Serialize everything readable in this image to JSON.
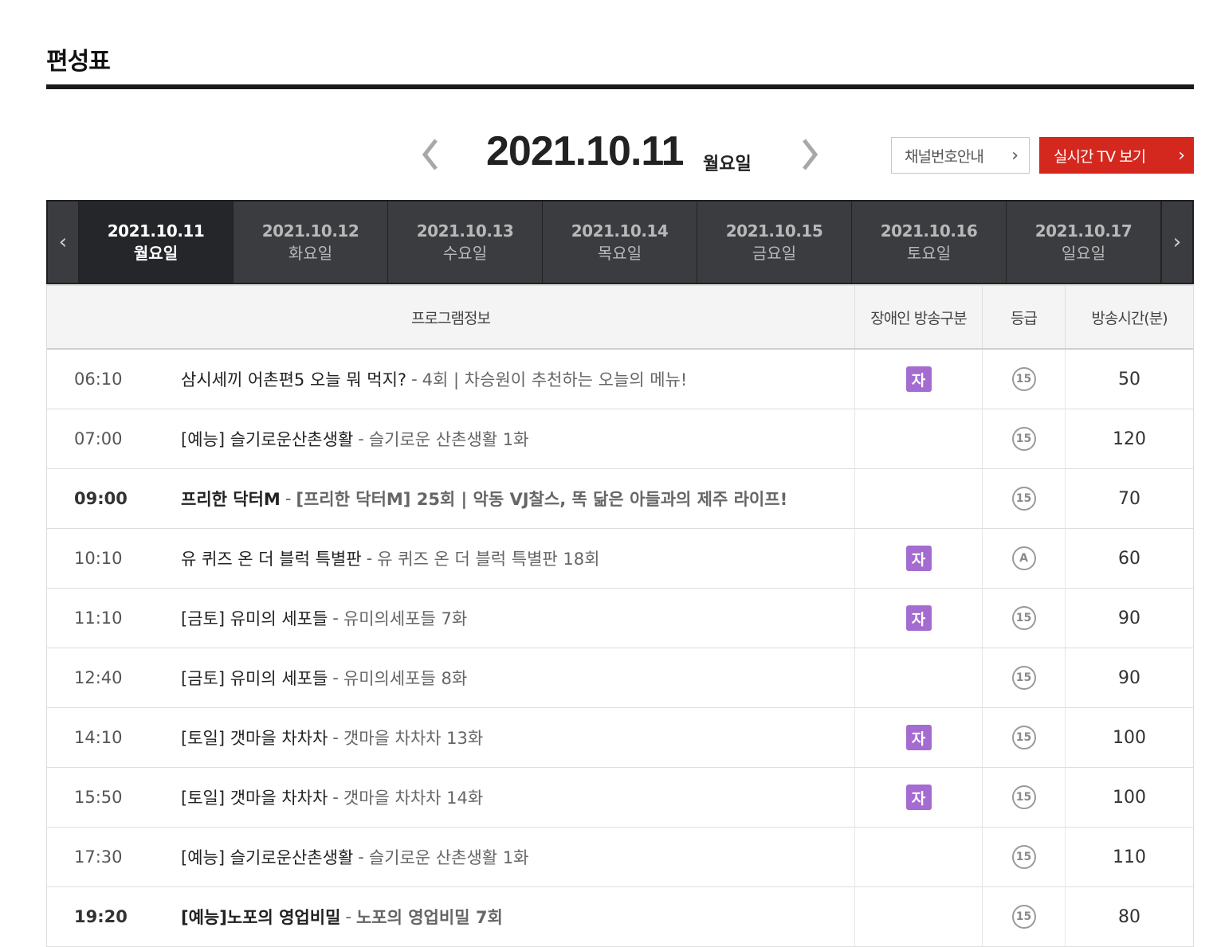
{
  "page": {
    "title": "편성표"
  },
  "date_header": {
    "date": "2021.10.11",
    "day": "월요일",
    "channel_button": "채널번호안내",
    "live_button": "실시간 TV 보기"
  },
  "tabs": [
    {
      "date": "2021.10.11",
      "day": "월요일",
      "active": true
    },
    {
      "date": "2021.10.12",
      "day": "화요일",
      "active": false
    },
    {
      "date": "2021.10.13",
      "day": "수요일",
      "active": false
    },
    {
      "date": "2021.10.14",
      "day": "목요일",
      "active": false
    },
    {
      "date": "2021.10.15",
      "day": "금요일",
      "active": false
    },
    {
      "date": "2021.10.16",
      "day": "토요일",
      "active": false
    },
    {
      "date": "2021.10.17",
      "day": "일요일",
      "active": false
    }
  ],
  "table": {
    "headers": {
      "info": "프로그램정보",
      "cc": "장애인 방송구분",
      "grade": "등급",
      "duration": "방송시간(분)"
    },
    "rows": [
      {
        "time": "06:10",
        "title": "삼시세끼 어촌편5 오늘 뭐 먹지?",
        "episode": "4회 | 차승원이 추천하는 오늘의 메뉴!",
        "cc": "자",
        "grade": "15",
        "duration": "50",
        "bold": false
      },
      {
        "time": "07:00",
        "title": "[예능] 슬기로운산촌생활",
        "episode": "슬기로운 산촌생활 1화",
        "cc": "",
        "grade": "15",
        "duration": "120",
        "bold": false
      },
      {
        "time": "09:00",
        "title": "프리한 닥터M",
        "episode": "[프리한 닥터M] 25회 | 악동 VJ찰스, 똑 닮은 아들과의 제주 라이프!",
        "cc": "",
        "grade": "15",
        "duration": "70",
        "bold": true
      },
      {
        "time": "10:10",
        "title": "유 퀴즈 온 더 블럭 특별판",
        "episode": "유 퀴즈 온 더 블럭 특별판 18회",
        "cc": "자",
        "grade": "A",
        "duration": "60",
        "bold": false
      },
      {
        "time": "11:10",
        "title": "[금토] 유미의 세포들",
        "episode": "유미의세포들 7화",
        "cc": "자",
        "grade": "15",
        "duration": "90",
        "bold": false
      },
      {
        "time": "12:40",
        "title": "[금토] 유미의 세포들",
        "episode": "유미의세포들 8화",
        "cc": "",
        "grade": "15",
        "duration": "90",
        "bold": false
      },
      {
        "time": "14:10",
        "title": "[토일] 갯마을 차차차",
        "episode": "갯마을 차차차 13화",
        "cc": "자",
        "grade": "15",
        "duration": "100",
        "bold": false
      },
      {
        "time": "15:50",
        "title": "[토일] 갯마을 차차차",
        "episode": "갯마을 차차차 14화",
        "cc": "자",
        "grade": "15",
        "duration": "100",
        "bold": false
      },
      {
        "time": "17:30",
        "title": "[예능] 슬기로운산촌생활",
        "episode": "슬기로운 산촌생활 1화",
        "cc": "",
        "grade": "15",
        "duration": "110",
        "bold": false
      },
      {
        "time": "19:20",
        "title": "[예능]노포의 영업비밀",
        "episode": "노포의 영업비밀 7회",
        "cc": "",
        "grade": "15",
        "duration": "80",
        "bold": true
      }
    ]
  },
  "colors": {
    "accent": "#d4271e",
    "tab_bg": "#3a3c40",
    "cc_badge": "#a46bd0"
  }
}
